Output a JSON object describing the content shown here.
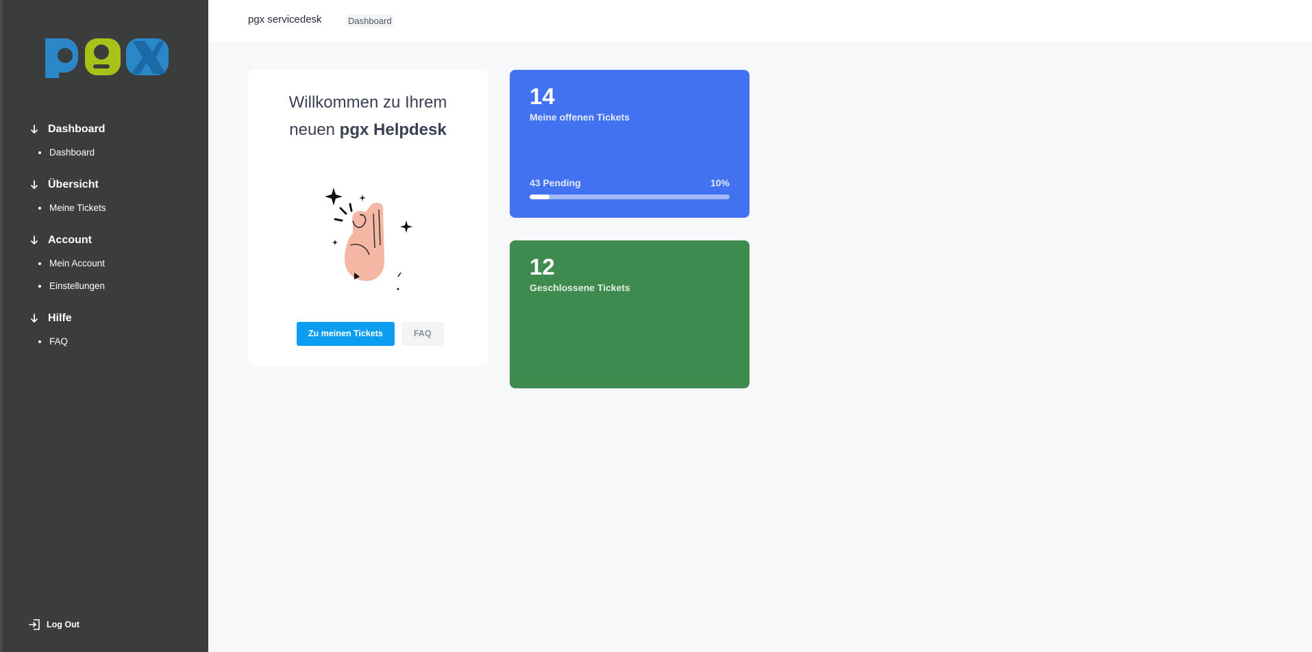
{
  "header": {
    "brand": "pgx servicedesk",
    "breadcrumb": "Dashboard"
  },
  "sidebar": {
    "logo_text": "pgx",
    "sections": [
      {
        "title": "Dashboard",
        "items": [
          "Dashboard"
        ]
      },
      {
        "title": "Übersicht",
        "items": [
          "Meine Tickets"
        ]
      },
      {
        "title": "Account",
        "items": [
          "Mein Account",
          "Einstellungen"
        ]
      },
      {
        "title": "Hilfe",
        "items": [
          "FAQ"
        ]
      }
    ],
    "logout_label": "Log Out"
  },
  "welcome": {
    "line1": "Willkommen zu Ihrem",
    "line2_prefix": "neuen ",
    "line2_bold": "pgx Helpdesk",
    "primary_button": "Zu meinen Tickets",
    "secondary_button": "FAQ"
  },
  "stats": {
    "open": {
      "count": "14",
      "label": "Meine offenen Tickets",
      "pending_label": "43 Pending",
      "percent_label": "10%",
      "progress_fraction": 0.1,
      "color": "#4272ef"
    },
    "closed": {
      "count": "12",
      "label": "Geschlossene Tickets",
      "color": "#3f8b4f"
    }
  },
  "colors": {
    "sidebar_bg": "#3b3d3c",
    "primary_button": "#0a9df0",
    "logo_blue": "#2b87c8",
    "logo_green": "#a8c21a"
  },
  "icons": {
    "section_arrow": "arrow-down-icon",
    "logout": "logout-icon",
    "illustration": "ok-hand-illustration"
  }
}
